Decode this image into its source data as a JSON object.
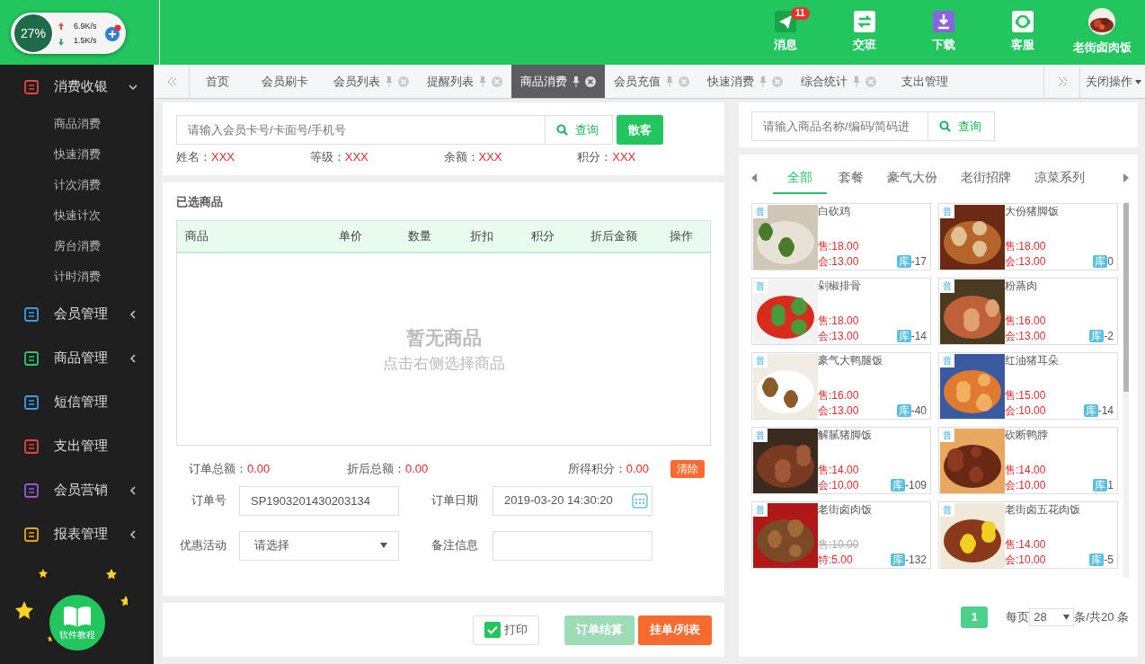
{
  "widget": {
    "percent": "27%",
    "up": "6.9K/s",
    "down": "1.5K/s"
  },
  "header_actions": [
    {
      "kind": "send",
      "label": "消息",
      "badge": "11"
    },
    {
      "kind": "swap",
      "label": "交班"
    },
    {
      "kind": "download",
      "label": "下载"
    },
    {
      "kind": "headset",
      "label": "客服"
    },
    {
      "kind": "avatar",
      "label": "老街卤肉饭"
    }
  ],
  "sidebar": {
    "items": [
      {
        "label": "消费收银",
        "color": "#e8453c",
        "expanded": true,
        "children": [
          {
            "label": "商品消费"
          },
          {
            "label": "快速消费"
          },
          {
            "label": "计次消费"
          },
          {
            "label": "快速计次"
          },
          {
            "label": "房台消费"
          },
          {
            "label": "计时消费"
          }
        ]
      },
      {
        "label": "会员管理",
        "color": "#3a9ee8",
        "expanded": false
      },
      {
        "label": "商品管理",
        "color": "#2ec76a",
        "expanded": false
      },
      {
        "label": "短信管理",
        "color": "#3a9ee8"
      },
      {
        "label": "支出管理",
        "color": "#e8453c"
      },
      {
        "label": "会员营销",
        "color": "#9b59d0",
        "expanded": false
      },
      {
        "label": "报表管理",
        "color": "#f0a020",
        "expanded": false
      }
    ],
    "tutorial": "软件教程"
  },
  "tabs": [
    {
      "label": "首页",
      "selected": false,
      "closable": false
    },
    {
      "label": "会员刷卡",
      "selected": false,
      "closable": false
    },
    {
      "label": "会员列表",
      "selected": false,
      "closable": true
    },
    {
      "label": "提醒列表",
      "selected": false,
      "closable": true
    },
    {
      "label": "商品消费",
      "selected": true,
      "closable": true
    },
    {
      "label": "会员充值",
      "selected": false,
      "closable": true
    },
    {
      "label": "快速消费",
      "selected": false,
      "closable": true
    },
    {
      "label": "综合统计",
      "selected": false,
      "closable": true
    },
    {
      "label": "支出管理",
      "selected": false,
      "closable": false
    }
  ],
  "tab_menu": "关闭操作",
  "member": {
    "placeholder": "请输入会员卡号/卡面号/手机号",
    "search": "查询",
    "walk_in": "散客",
    "fields": [
      {
        "label": "姓名：",
        "value": "XXX"
      },
      {
        "label": "等级：",
        "value": "XXX"
      },
      {
        "label": "余额：",
        "value": "XXX"
      },
      {
        "label": "积分：",
        "value": "XXX"
      }
    ]
  },
  "selected_goods": {
    "title": "已选商品",
    "columns": [
      "商品",
      "单价",
      "数量",
      "折扣",
      "积分",
      "折后金额",
      "操作"
    ],
    "empty_title": "暂无商品",
    "empty_hint": "点击右侧选择商品"
  },
  "totals": [
    {
      "label": "订单总额：",
      "value": "0.00"
    },
    {
      "label": "折后总额：",
      "value": "0.00"
    },
    {
      "label": "所得积分：",
      "value": "0.00"
    }
  ],
  "clear": "清除",
  "order": {
    "number_label": "订单号",
    "number": "SP1903201430203134",
    "date_label": "订单日期",
    "date": "2019-03-20 14:30:20",
    "promo_label": "优惠活动",
    "promo": "请选择",
    "note_label": "备注信息"
  },
  "footer": {
    "print": {
      "label": "打印",
      "checked": true
    },
    "checkout": {
      "label": "订单结算",
      "disabled": true
    },
    "hold": {
      "label": "挂单/列表"
    }
  },
  "goods_search": {
    "placeholder": "请输入商品名称/编码/简码进",
    "search": "查询"
  },
  "categories": [
    {
      "label": "全部",
      "selected": true
    },
    {
      "label": "套餐",
      "selected": false
    },
    {
      "label": "豪气大份",
      "selected": false
    },
    {
      "label": "老街招牌",
      "selected": false
    },
    {
      "label": "凉菜系列",
      "selected": false
    }
  ],
  "products": [
    {
      "tag": "普",
      "name": "白砍鸡",
      "price": "售:18.00",
      "price_struck": false,
      "member_price": "会:13.00",
      "stock_label": "库",
      "stock": "-17"
    },
    {
      "tag": "普",
      "name": "大份猪脚饭",
      "price": "售:18.00",
      "price_struck": false,
      "member_price": "会:13.00",
      "stock_label": "库",
      "stock": "0"
    },
    {
      "tag": "普",
      "name": "剁椒排骨",
      "price": "售:18.00",
      "price_struck": false,
      "member_price": "会:13.00",
      "stock_label": "库",
      "stock": "-14"
    },
    {
      "tag": "普",
      "name": "粉蒸肉",
      "price": "售:16.00",
      "price_struck": false,
      "member_price": "会:13.00",
      "stock_label": "库",
      "stock": "-2"
    },
    {
      "tag": "普",
      "name": "豪气大鸭腿饭",
      "price": "售:16.00",
      "price_struck": false,
      "member_price": "会:13.00",
      "stock_label": "库",
      "stock": "-40"
    },
    {
      "tag": "普",
      "name": "红油猪耳朵",
      "price": "售:15.00",
      "price_struck": false,
      "member_price": "会:10.00",
      "stock_label": "库",
      "stock": "-14"
    },
    {
      "tag": "普",
      "name": "解腻猪脚饭",
      "price": "售:14.00",
      "price_struck": false,
      "member_price": "会:10.00",
      "stock_label": "库",
      "stock": "-109"
    },
    {
      "tag": "普",
      "name": "砍断鸭脖",
      "price": "售:14.00",
      "price_struck": false,
      "member_price": "会:10.00",
      "stock_label": "库",
      "stock": "1"
    },
    {
      "tag": "普",
      "name": "老街卤肉饭",
      "price": "售:10.00",
      "price_struck": true,
      "member_price": "特:5.00",
      "stock_label": "库",
      "stock": "-132"
    },
    {
      "tag": "普",
      "name": "老街卤五花肉饭",
      "price": "售:14.00",
      "price_struck": false,
      "member_price": "会:10.00",
      "stock_label": "库",
      "stock": "-5"
    }
  ],
  "pagination": {
    "page": "1",
    "per_page_label": "每页",
    "per_page": "28",
    "total": "条/共20 条"
  }
}
